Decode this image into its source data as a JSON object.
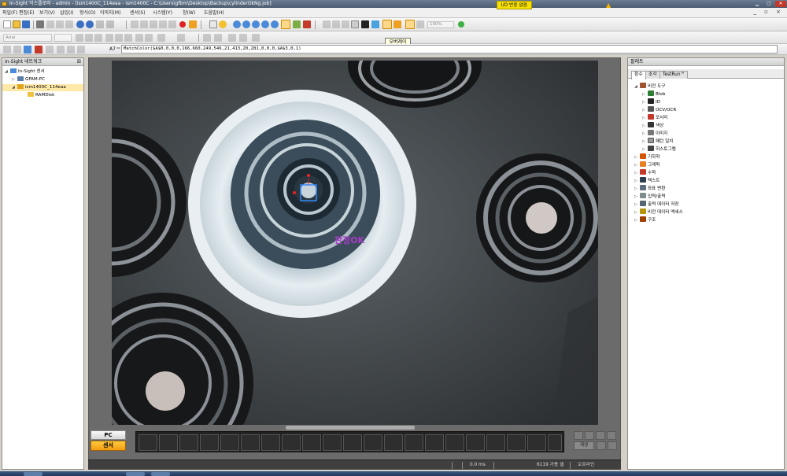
{
  "window": {
    "title": "In-Sight 익스플로러 - admin - [ism1400C_114eaa - ism1400C - C:\\Users\\gfbm\\Desktop\\Backup\\cylinderOkNg.job]"
  },
  "menu": {
    "items": [
      "파일(F)",
      "편집(E)",
      "보기(V)",
      "삽입(I)",
      "형식(O)",
      "이미지(M)",
      "센서(S)",
      "시스템(Y)",
      "창(W)",
      "도움말(H)"
    ]
  },
  "toolbar": {
    "zoom_value": "100%",
    "font_value": "Arial",
    "tooltip": "오버레이"
  },
  "formula_bar": {
    "cell_ref": "A7",
    "fx": "=",
    "formula": "MatchColor($A$0,0,0,0,166,660,249,546,21,413,20,281,0,0,0,$A$3,0,1)"
  },
  "left_panel": {
    "title": "In-Sight 네트워크",
    "tree": [
      {
        "label": "In-Sight 센서"
      },
      {
        "label": "GFAM-PC"
      },
      {
        "label": "ism1400C_114eaa"
      },
      {
        "label": "RAMDisk"
      }
    ]
  },
  "image_view": {
    "overlay_text": "판정OK",
    "pc_label": "PC",
    "sensor_label": "센서",
    "film_play_label": "재생"
  },
  "status_bar": {
    "time": "0.0 ms",
    "io": "I/O 반응 없음",
    "storage": "6119 가용 셀",
    "mode": "오프라인"
  },
  "right_panel": {
    "title": "팔레트",
    "tabs": [
      "함수",
      "조각",
      "TestRun™"
    ],
    "items": [
      {
        "label": "비전 도구",
        "level": 0,
        "expanded": true
      },
      {
        "label": "Blob",
        "level": 1
      },
      {
        "label": "ID",
        "level": 1
      },
      {
        "label": "OCV/OCR",
        "level": 1
      },
      {
        "label": "모서리",
        "level": 1
      },
      {
        "label": "색상",
        "level": 1
      },
      {
        "label": "이미지",
        "level": 1
      },
      {
        "label": "패턴 일치",
        "level": 1
      },
      {
        "label": "히스토그램",
        "level": 1
      },
      {
        "label": "기하학",
        "level": 0
      },
      {
        "label": "그래픽",
        "level": 0
      },
      {
        "label": "수학",
        "level": 0
      },
      {
        "label": "텍스트",
        "level": 0
      },
      {
        "label": "좌표 변환",
        "level": 0
      },
      {
        "label": "입력/출력",
        "level": 0
      },
      {
        "label": "출력 데이터 저장",
        "level": 0
      },
      {
        "label": "비전 데이터 액세스",
        "level": 0
      },
      {
        "label": "구조",
        "level": 0
      }
    ]
  },
  "colors": {
    "accent": "#f39c12",
    "selection": "#ffe9a8",
    "io_warning": "#f7e000"
  }
}
